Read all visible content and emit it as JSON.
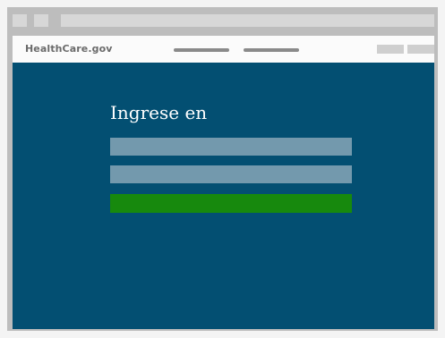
{
  "browser": {
    "chrome_buttons": [
      "placeholder-button",
      "placeholder-button"
    ],
    "address_bar": ""
  },
  "header": {
    "logo_text": "HealthCare.gov",
    "nav_links": [
      "",
      ""
    ],
    "actions": [
      "",
      ""
    ]
  },
  "login": {
    "title": "Ingrese en",
    "username_value": "",
    "password_value": "",
    "submit_label": ""
  },
  "colors": {
    "page_background": "#f4f4f4",
    "browser_frame": "#bdbdbd",
    "main_background": "#034f72",
    "input_fill": "#7399ad",
    "submit_fill": "#17890d",
    "header_background": "#fbfbfb",
    "logo_text": "#6b6b6b"
  }
}
